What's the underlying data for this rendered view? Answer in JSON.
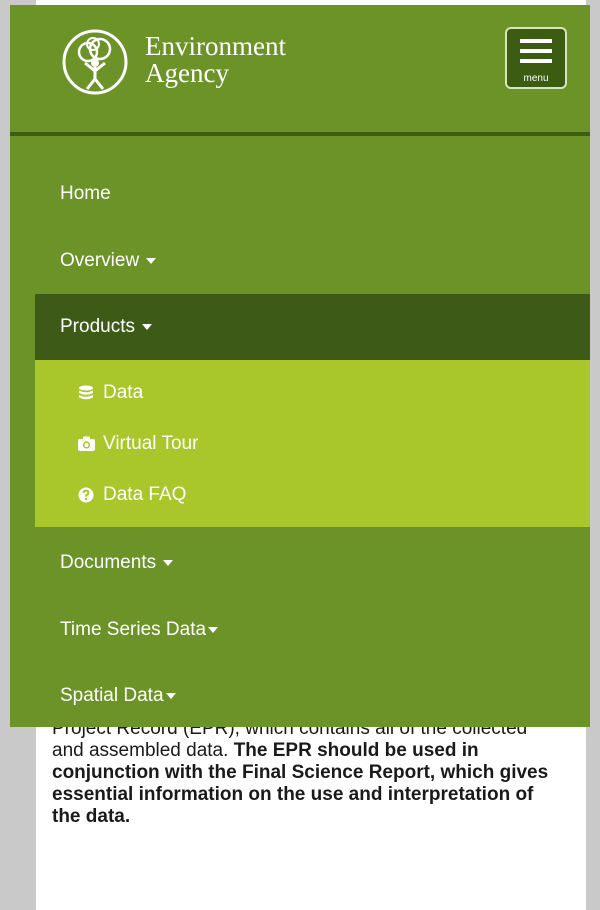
{
  "brand": {
    "line1": "Environment",
    "line2": "Agency"
  },
  "menu_button": {
    "label": "menu"
  },
  "nav": {
    "home": "Home",
    "overview": "Overview",
    "products": "Products",
    "products_submenu": [
      {
        "label": "Data",
        "icon": "database-icon"
      },
      {
        "label": "Virtual Tour",
        "icon": "camera-icon"
      },
      {
        "label": "Data FAQ",
        "icon": "question-circle-icon"
      }
    ],
    "documents": "Documents",
    "time_series": "Time Series Data",
    "spatial": "Spatial Data"
  },
  "content": {
    "text_plain": "Project Record (EPR), which contains all of the collected and assembled data. ",
    "text_bold": "The EPR should be used in conjunction with the Final Science Report, which gives essential information on the use and interpretation of the data."
  },
  "colors": {
    "header_green": "#6c9328",
    "active_dark_green": "#3d5b17",
    "submenu_lime": "#a9c72b"
  }
}
